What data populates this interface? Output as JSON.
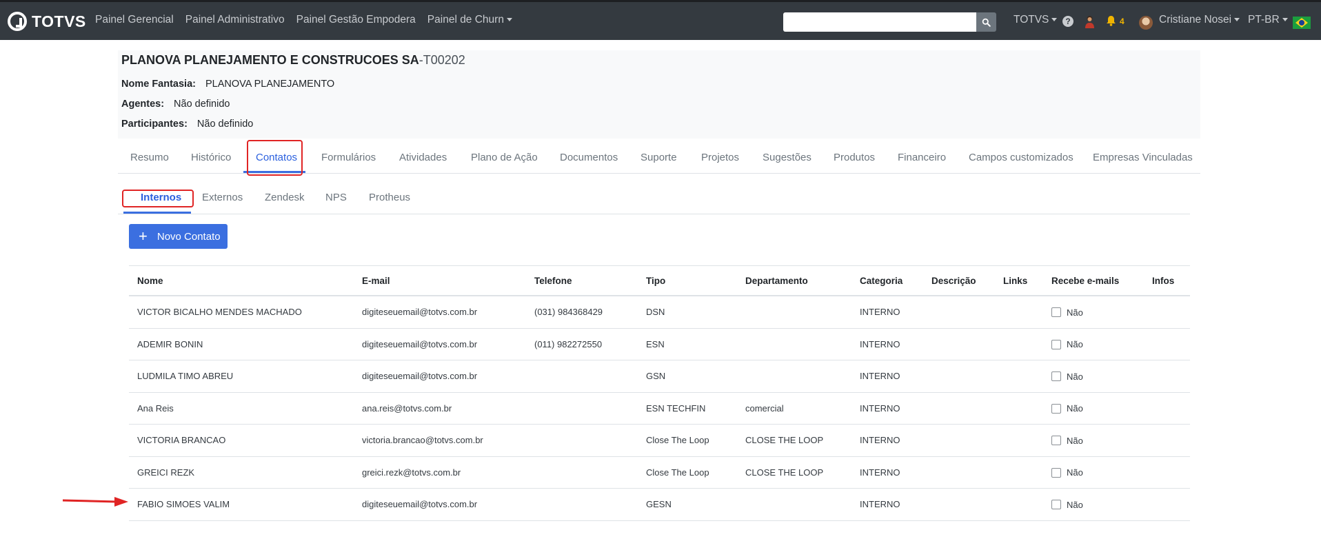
{
  "navbar": {
    "brand": "TOTVS",
    "links": [
      "Painel Gerencial",
      "Painel Administrativo",
      "Painel Gestão Empodera",
      "Painel de Churn"
    ],
    "search_placeholder": "",
    "org_menu": "TOTVS",
    "notifications_count": "4",
    "user_name": "Cristiane Nosei",
    "language": "PT-BR"
  },
  "company": {
    "name": "PLANOVA PLANEJAMENTO E CONSTRUCOES SA",
    "code": "-T00202",
    "fields": [
      {
        "label": "Nome Fantasia:",
        "value": "PLANOVA PLANEJAMENTO"
      },
      {
        "label": "Agentes:",
        "value": "Não definido"
      },
      {
        "label": "Participantes:",
        "value": "Não definido"
      }
    ]
  },
  "main_tabs": [
    "Resumo",
    "Histórico",
    "Contatos",
    "Formulários",
    "Atividades",
    "Plano de Ação",
    "Documentos",
    "Suporte",
    "Projetos",
    "Sugestões",
    "Produtos",
    "Financeiro",
    "Campos customizados",
    "Empresas Vinculadas"
  ],
  "sub_tabs": [
    "Internos",
    "Externos",
    "Zendesk",
    "NPS",
    "Protheus"
  ],
  "new_contact_label": "Novo Contato",
  "table": {
    "headers": [
      "Nome",
      "E-mail",
      "Telefone",
      "Tipo",
      "Departamento",
      "Categoria",
      "Descrição",
      "Links",
      "Recebe e-mails",
      "Infos"
    ],
    "rows": [
      {
        "nome": "VICTOR BICALHO MENDES MACHADO",
        "email": "digiteseuemail@totvs.com.br",
        "telefone": "(031) 984368429",
        "tipo": "DSN",
        "departamento": "",
        "categoria": "INTERNO",
        "recebe": "Não"
      },
      {
        "nome": "ADEMIR BONIN",
        "email": "digiteseuemail@totvs.com.br",
        "telefone": "(011) 982272550",
        "tipo": "ESN",
        "departamento": "",
        "categoria": "INTERNO",
        "recebe": "Não"
      },
      {
        "nome": "LUDMILA TIMO ABREU",
        "email": "digiteseuemail@totvs.com.br",
        "telefone": "",
        "tipo": "GSN",
        "departamento": "",
        "categoria": "INTERNO",
        "recebe": "Não"
      },
      {
        "nome": "Ana Reis",
        "email": "ana.reis@totvs.com.br",
        "telefone": "",
        "tipo": "ESN TECHFIN",
        "departamento": "comercial",
        "categoria": "INTERNO",
        "recebe": "Não"
      },
      {
        "nome": "VICTORIA BRANCAO",
        "email": "victoria.brancao@totvs.com.br",
        "telefone": "",
        "tipo": "Close The Loop",
        "departamento": "CLOSE THE LOOP",
        "categoria": "INTERNO",
        "recebe": "Não"
      },
      {
        "nome": "GREICI REZK",
        "email": "greici.rezk@totvs.com.br",
        "telefone": "",
        "tipo": "Close The Loop",
        "departamento": "CLOSE THE LOOP",
        "categoria": "INTERNO",
        "recebe": "Não"
      },
      {
        "nome": "FABIO SIMOES VALIM",
        "email": "digiteseuemail@totvs.com.br",
        "telefone": "",
        "tipo": "GESN",
        "departamento": "",
        "categoria": "INTERNO",
        "recebe": "Não"
      }
    ]
  },
  "colors": {
    "navbar": "#343a40",
    "accent": "#3b6fe0",
    "highlight": "#e02424"
  }
}
